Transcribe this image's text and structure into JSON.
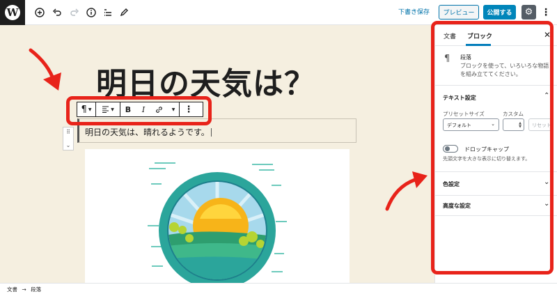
{
  "toolbar": {
    "logo_letter": "W",
    "add_icon": "plus-circle-icon",
    "undo_icon": "undo-icon",
    "redo_icon": "redo-icon",
    "info_icon": "info-icon",
    "outline_icon": "list-icon",
    "tools_icon": "pencil-icon",
    "save_draft": "下書き保存",
    "preview": "プレビュー",
    "publish": "公開する",
    "settings_icon": "gear-icon",
    "more_icon": "more-vertical-icon"
  },
  "editor": {
    "title": "明日の天気は？",
    "paragraph": "明日の天気は、晴れるようです。",
    "block_toolbar": {
      "paragraph_icon": "pilcrow-icon",
      "align_icon": "align-left-icon",
      "bold": "B",
      "italic": "I",
      "link_icon": "link-icon",
      "more_icon": "more-vertical-icon"
    },
    "image_alt_icon": "sun-landscape-illustration"
  },
  "sidebar": {
    "tabs": [
      "文書",
      "ブロック"
    ],
    "active_tab": "ブロック",
    "block_name": "段落",
    "block_description": "ブロックを使って、いろいろな物語を組み立ててください。",
    "text_settings": {
      "title": "テキスト設定",
      "preset_label": "プリセットサイズ",
      "custom_label": "カスタム",
      "preset_value": "デフォルト",
      "reset": "リセット",
      "drop_cap_label": "ドロップキャップ",
      "drop_cap_help": "先頭文字を大きな表示に切り替えます。"
    },
    "color_settings": "色設定",
    "advanced": "高度な設定"
  },
  "breadcrumb": {
    "root": "文書",
    "separator": "→",
    "current": "段落"
  },
  "colors": {
    "highlight": "#e8231a",
    "accent": "#0085ba",
    "canvas_bg": "#f5efe0"
  }
}
